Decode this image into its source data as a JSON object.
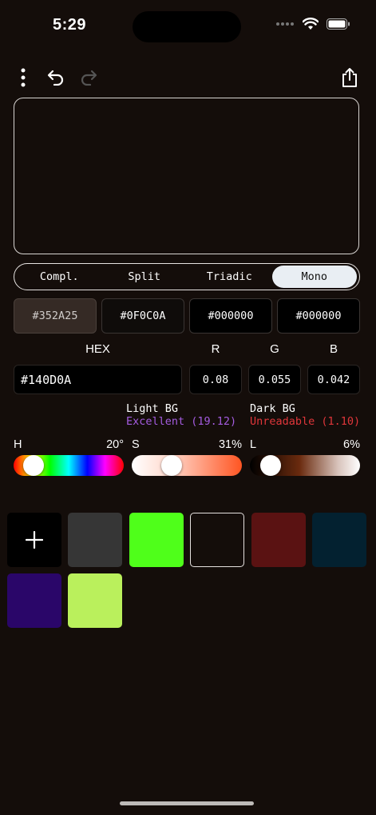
{
  "status": {
    "time": "5:29"
  },
  "schemes": [
    {
      "label": "Compl.",
      "active": false
    },
    {
      "label": "Split",
      "active": false
    },
    {
      "label": "Triadic",
      "active": false
    },
    {
      "label": "Mono",
      "active": true
    }
  ],
  "scheme_swatches": [
    {
      "hex": "#352A25",
      "bg": "#352A25",
      "fg": "#CFCBC9"
    },
    {
      "hex": "#0F0C0A",
      "bg": "#0F0C0A",
      "fg": "#FFFFFF"
    },
    {
      "hex": "#000000",
      "bg": "#000000",
      "fg": "#FFFFFF"
    },
    {
      "hex": "#000000",
      "bg": "#000000",
      "fg": "#FFFFFF"
    }
  ],
  "color_inputs": {
    "hex_label": "HEX",
    "hex_value": "#140D0A",
    "r_label": "R",
    "r_value": "0.08",
    "g_label": "G",
    "g_value": "0.055",
    "b_label": "B",
    "b_value": "0.042"
  },
  "contrast": {
    "light_label": "Light BG",
    "light_value": "Excellent (19.12)",
    "light_color": "#A45CE0",
    "dark_label": "Dark BG",
    "dark_value": "Unreadable (1.10)",
    "dark_color": "#E0363A"
  },
  "sliders": {
    "h": {
      "label": "H",
      "value": "20°",
      "level": 0.055
    },
    "s": {
      "label": "S",
      "value": "31%",
      "level": 0.31
    },
    "l": {
      "label": "L",
      "value": "6%",
      "level": 0.06
    }
  },
  "palette": [
    "#363636",
    "#4FFF1A",
    "#140D0A",
    "#5A1212",
    "#032130",
    "#2A0669",
    "#BAF05C"
  ],
  "colors": {
    "background": "#140D0A",
    "accent_light": "#E9EEF3"
  }
}
